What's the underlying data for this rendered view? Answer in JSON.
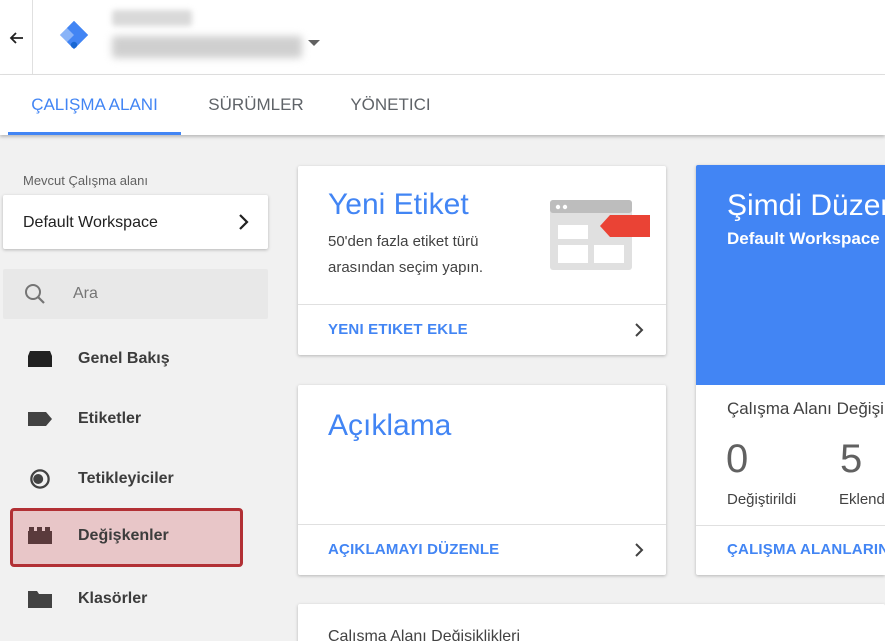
{
  "header": {
    "back_icon": "arrow-left-icon",
    "logo_icon": "tag-manager-logo",
    "account_name": "",
    "container_name": ""
  },
  "tabs": [
    {
      "label": "ÇALIŞMA ALANI",
      "active": true
    },
    {
      "label": "SÜRÜMLER",
      "active": false
    },
    {
      "label": "YÖNETICI",
      "active": false
    }
  ],
  "sidebar": {
    "workspace_label": "Mevcut Çalışma alanı",
    "workspace_name": "Default Workspace",
    "search_placeholder": "Ara",
    "items": [
      {
        "label": "Genel Bakış",
        "icon": "overview-icon"
      },
      {
        "label": "Etiketler",
        "icon": "tag-icon"
      },
      {
        "label": "Tetikleyiciler",
        "icon": "trigger-icon"
      },
      {
        "label": "Değişkenler",
        "icon": "variables-icon",
        "highlighted": true
      },
      {
        "label": "Klasörler",
        "icon": "folder-icon"
      }
    ]
  },
  "new_tag": {
    "title": "Yeni Etiket",
    "description": "50'den fazla etiket türü arasından seçim yapın.",
    "link": "YENI ETIKET EKLE"
  },
  "description_card": {
    "title": "Açıklama",
    "link": "AÇIKLAMAYI DÜZENLE"
  },
  "now_editing": {
    "title": "Şimdi Düzenleniyor",
    "workspace": "Default Workspace",
    "changes_heading": "Çalışma Alanı Değişiklikleri",
    "stats": [
      {
        "value": "0",
        "label": "Değiştirildi"
      },
      {
        "value": "5",
        "label": "Eklendi"
      }
    ],
    "link": "ÇALIŞMA ALANLARINI YÖNET"
  },
  "bottom_card": {
    "title": "Çalışma Alanı Değişiklikleri"
  },
  "colors": {
    "accent": "#4285f4",
    "highlight_border": "#b23035",
    "highlight_fill": "#e8c6c8",
    "tag_red": "#ea4335"
  }
}
